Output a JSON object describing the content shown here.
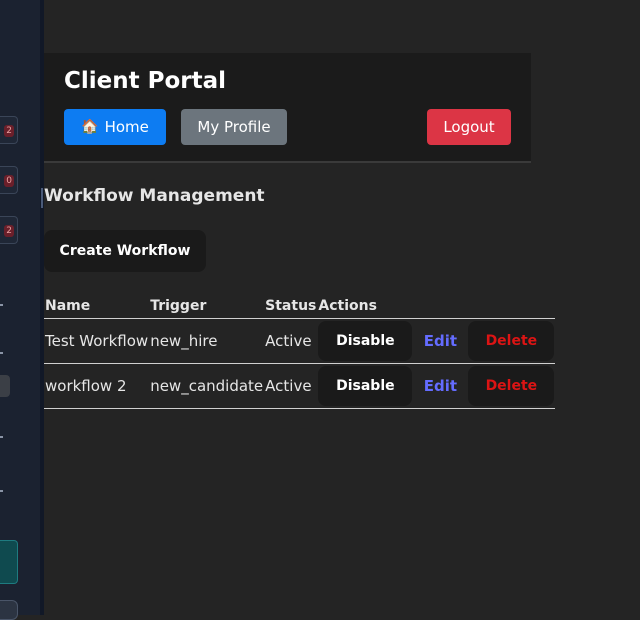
{
  "header": {
    "title": "Client Portal",
    "home_icon": "🏠",
    "home_label": "Home",
    "profile_label": "My Profile",
    "logout_label": "Logout"
  },
  "main": {
    "section_title": "Workflow Management",
    "create_label": "Create Workflow",
    "columns": [
      "Name",
      "Trigger",
      "Status",
      "Actions"
    ],
    "rows": [
      {
        "name": "Test Workflow",
        "trigger": "new_hire",
        "status": "Active",
        "toggle": "Disable",
        "edit": "Edit",
        "delete": "Delete"
      },
      {
        "name": "workflow 2",
        "trigger": "new_candidate",
        "status": "Active",
        "toggle": "Disable",
        "edit": "Edit",
        "delete": "Delete"
      }
    ]
  },
  "sidebar": {
    "badges": [
      "2",
      "0",
      "2"
    ]
  },
  "colors": {
    "home": "#0d7cf2",
    "profile": "#6c757d",
    "logout": "#dc3545",
    "edit": "#646cff",
    "delete": "#dc1414"
  }
}
